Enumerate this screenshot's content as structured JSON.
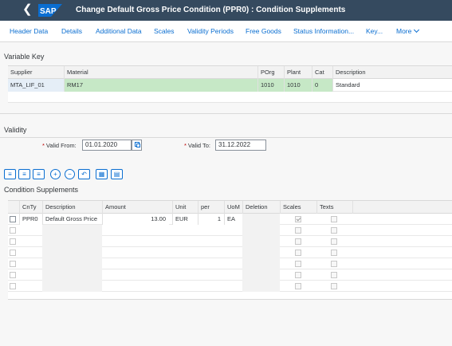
{
  "shell": {
    "back_icon": "chevron-left-icon",
    "logo_text": "SAP",
    "logo_color": "#0a6ed1",
    "title": "Change Default Gross Price Condition (PPR0) : Condition Supplements"
  },
  "tabs": [
    {
      "label": "Header Data"
    },
    {
      "label": "Details"
    },
    {
      "label": "Additional Data"
    },
    {
      "label": "Scales"
    },
    {
      "label": "Validity Periods"
    },
    {
      "label": "Free Goods"
    },
    {
      "label": "Status Information..."
    },
    {
      "label": "Key..."
    },
    {
      "label": "More"
    }
  ],
  "variable_key": {
    "title": "Variable Key",
    "columns": [
      "Supplier",
      "Material",
      "POrg",
      "Plant",
      "Cat",
      "Description"
    ],
    "row": {
      "supplier": "MTA_LIF_01",
      "material": "RM17",
      "porg": "1010",
      "plant": "1010",
      "cat": "0",
      "description": "Standard"
    },
    "highlight_color": "#c6e8c6",
    "selected_color": "#e5eef7"
  },
  "validity": {
    "title": "Validity",
    "from_label": "Valid From:",
    "from_value": "01.01.2020",
    "to_label": "Valid To:",
    "to_value": "31.12.2022"
  },
  "toolbar": {
    "icons": [
      "select-all-icon",
      "deselect-all-icon",
      "select-block-icon",
      "insert-row-icon",
      "delete-row-icon",
      "undo-icon",
      "details-icon",
      "table-settings-icon"
    ]
  },
  "supplements": {
    "title": "Condition Supplements",
    "columns": [
      "CnTy",
      "Description",
      "Amount",
      "Unit",
      "per",
      "UoM",
      "Deletion",
      "Scales",
      "Texts"
    ],
    "rows": [
      {
        "cnty": "PPR0",
        "description": "Default Gross Price",
        "amount": "13.00",
        "unit": "EUR",
        "per": "1",
        "uom": "EA",
        "scales": true
      }
    ]
  }
}
